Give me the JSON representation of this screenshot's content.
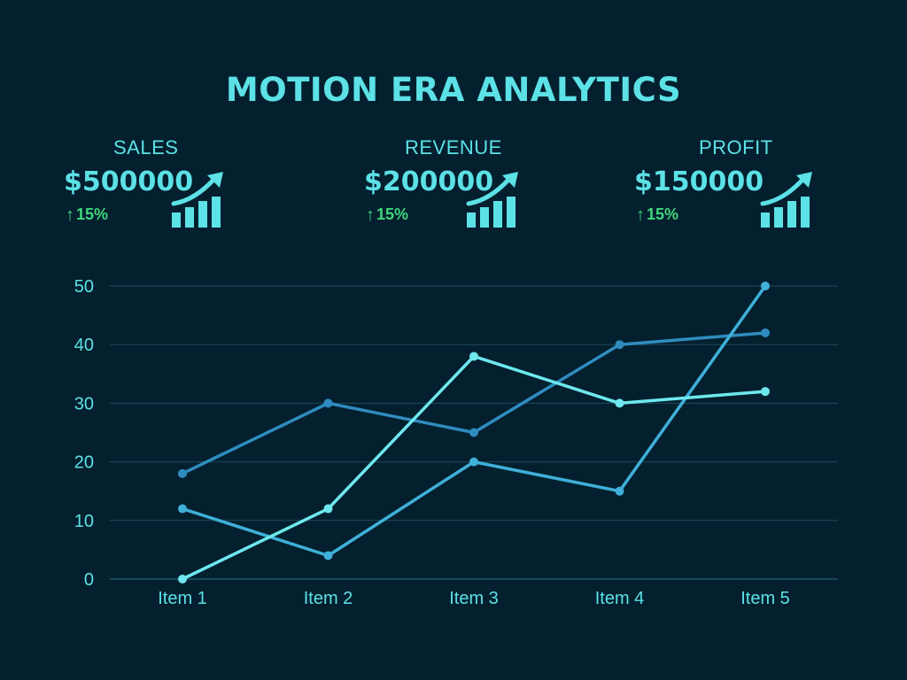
{
  "title": "MOTION ERA ANALYTICS",
  "kpis": [
    {
      "label": "SALES",
      "value": "$500000",
      "change": "15%"
    },
    {
      "label": "REVENUE",
      "value": "$200000",
      "change": "15%"
    },
    {
      "label": "PROFIT",
      "value": "$150000",
      "change": "15%"
    }
  ],
  "icons": {
    "trend": "bar-chart-growth-icon",
    "change": "up-arrow-icon"
  },
  "colors": {
    "background": "#04202f",
    "accent": "#5ce1e6",
    "positive": "#3fd67a",
    "gridline": "#1e4a5c"
  },
  "chart_data": {
    "type": "line",
    "categories": [
      "Item 1",
      "Item 2",
      "Item 3",
      "Item 4",
      "Item 5"
    ],
    "series": [
      {
        "values": [
          18,
          30,
          25,
          40,
          42
        ],
        "color": "#2f8cbf"
      },
      {
        "values": [
          12,
          4,
          20,
          15,
          50
        ],
        "color": "#3fb0d9"
      },
      {
        "values": [
          0,
          12,
          38,
          30,
          32
        ],
        "color": "#6ee8ee"
      }
    ],
    "ylim": [
      0,
      50
    ],
    "yticks": [
      "0",
      "10",
      "20",
      "30",
      "40",
      "50"
    ],
    "grid": true,
    "legend": "none"
  }
}
